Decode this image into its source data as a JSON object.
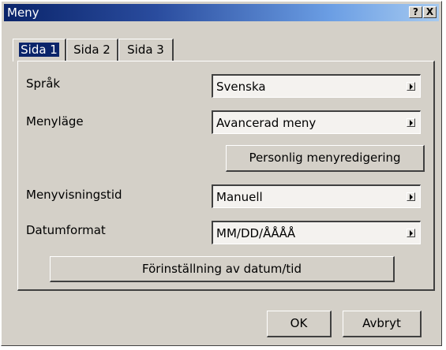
{
  "window": {
    "title": "Meny",
    "help_label": "?",
    "close_label": "X"
  },
  "tabs": [
    {
      "label": "Sida 1",
      "active": true
    },
    {
      "label": "Sida 2",
      "active": false
    },
    {
      "label": "Sida 3",
      "active": false
    }
  ],
  "settings": {
    "language": {
      "label": "Språk",
      "value": "Svenska"
    },
    "menu_mode": {
      "label": "Menyläge",
      "value": "Avancerad meny"
    },
    "custom_menu_button": "Personlig menyredigering",
    "menu_display_time": {
      "label": "Menyvisningstid",
      "value": "Manuell"
    },
    "date_format": {
      "label": "Datumformat",
      "value": "MM/DD/ÅÅÅÅ"
    },
    "date_time_button": "Förinställning av datum/tid"
  },
  "footer": {
    "ok_label": "OK",
    "cancel_label": "Avbryt"
  },
  "colors": {
    "face": "#d4d0c8",
    "title_start": "#0a246a",
    "title_end": "#a6caf0",
    "active_tab": "#0a246a"
  }
}
